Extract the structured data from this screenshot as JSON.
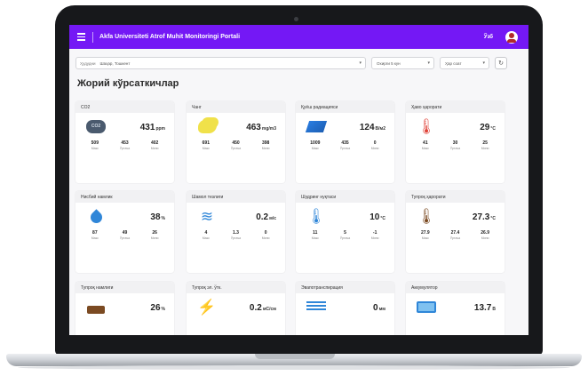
{
  "app": {
    "title": "Akfa Universiteti Atrof Muhit Monitoringi Portali",
    "lang": "Ўзб"
  },
  "filters": {
    "region_label": "Ҳудудни",
    "region_value": "Шаҳар, Тошкент",
    "period": "Охирги 5 кун",
    "interval": "Ҳар соат"
  },
  "section_title": "Жорий кўрсаткичлар",
  "colors": {
    "appbar": "#7418f5",
    "card_head": "#f1f1f3"
  },
  "cards": [
    {
      "title": "CO2",
      "icon": "co2-cloud-icon",
      "value": "431",
      "unit": "ppm",
      "stats": [
        {
          "value": "509",
          "label": "Макс"
        },
        {
          "value": "453",
          "label": "Ўртача"
        },
        {
          "value": "402",
          "label": "Мини"
        }
      ]
    },
    {
      "title": "Чанг",
      "icon": "dust-icon",
      "value": "463",
      "unit": "mg/m3",
      "stats": [
        {
          "value": "691",
          "label": "Макс"
        },
        {
          "value": "450",
          "label": "Ўртача"
        },
        {
          "value": "398",
          "label": "Мини"
        }
      ]
    },
    {
      "title": "Қуёш радиацияси",
      "icon": "solar-panel-icon",
      "value": "124",
      "unit": "В/м2",
      "stats": [
        {
          "value": "1009",
          "label": "Макс"
        },
        {
          "value": "435",
          "label": "Ўртача"
        },
        {
          "value": "0",
          "label": "Мини"
        }
      ]
    },
    {
      "title": "Ҳаво ҳарорати",
      "icon": "air-temperature-icon",
      "value": "29",
      "unit": "°C",
      "stats": [
        {
          "value": "41",
          "label": "Макс"
        },
        {
          "value": "30",
          "label": "Ўртача"
        },
        {
          "value": "25",
          "label": "Мини"
        }
      ]
    },
    {
      "title": "Нисбий намлик",
      "icon": "humidity-drop-icon",
      "value": "38",
      "unit": "%",
      "stats": [
        {
          "value": "87",
          "label": "Макс"
        },
        {
          "value": "49",
          "label": "Ўртача"
        },
        {
          "value": "26",
          "label": "Мини"
        }
      ]
    },
    {
      "title": "Шамол тезлиги",
      "icon": "wind-icon",
      "value": "0.2",
      "unit": "м/с",
      "stats": [
        {
          "value": "4",
          "label": "Макс"
        },
        {
          "value": "1.3",
          "label": "Ўртача"
        },
        {
          "value": "0",
          "label": "Мини"
        }
      ]
    },
    {
      "title": "Шудринг нуқтаси",
      "icon": "dew-point-icon",
      "value": "10",
      "unit": "°C",
      "stats": [
        {
          "value": "11",
          "label": "Макс"
        },
        {
          "value": "5",
          "label": "Ўртача"
        },
        {
          "value": "-1",
          "label": "Мини"
        }
      ]
    },
    {
      "title": "Тупроқ ҳарорати",
      "icon": "soil-temperature-icon",
      "value": "27.3",
      "unit": "°C",
      "stats": [
        {
          "value": "27.9",
          "label": "Макс"
        },
        {
          "value": "27.4",
          "label": "Ўртача"
        },
        {
          "value": "26.9",
          "label": "Мини"
        }
      ]
    },
    {
      "title": "Тупроқ намлиги",
      "icon": "soil-moisture-icon",
      "value": "26",
      "unit": "%",
      "stats": []
    },
    {
      "title": "Тупроқ эл. ўтк.",
      "icon": "soil-conductivity-icon",
      "value": "0.2",
      "unit": "мС/см",
      "stats": []
    },
    {
      "title": "Эвапотранспирация",
      "icon": "evapotranspiration-icon",
      "value": "0",
      "unit": "мм",
      "stats": []
    },
    {
      "title": "Аккумулятор",
      "icon": "battery-icon",
      "value": "13.7",
      "unit": "В",
      "stats": []
    }
  ]
}
